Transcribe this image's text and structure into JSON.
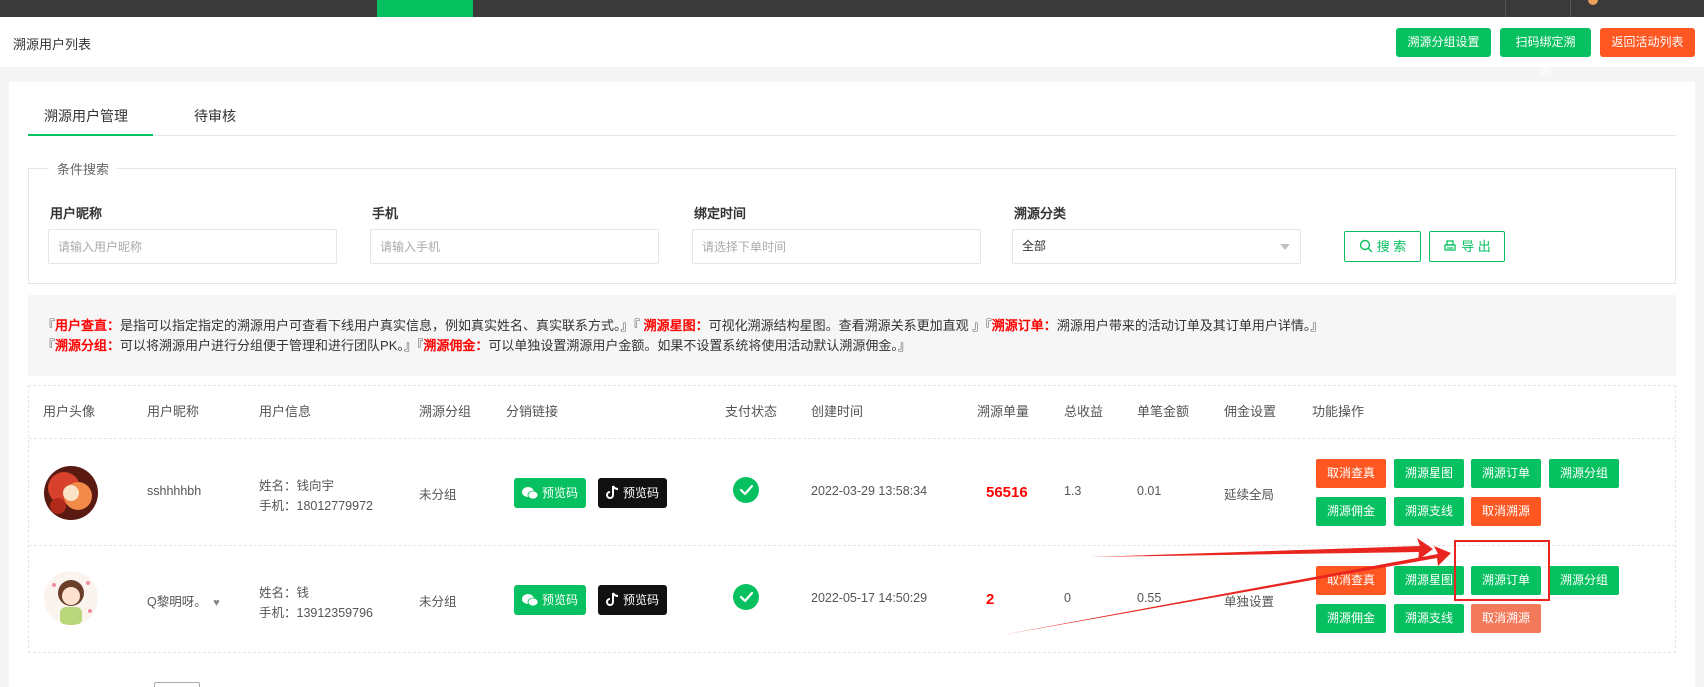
{
  "header": {
    "title": "溯源用户列表",
    "buttons": {
      "group_settings": "溯源分组设置",
      "scan_bind": "扫码绑定溯源",
      "back_to_list": "返回活动列表"
    }
  },
  "tabs": [
    {
      "label": "溯源用户管理",
      "active": true
    },
    {
      "label": "待审核",
      "active": false
    }
  ],
  "search": {
    "legend": "条件搜索",
    "fields": {
      "nickname": {
        "label": "用户昵称",
        "placeholder": "请输入用户昵称"
      },
      "phone": {
        "label": "手机",
        "placeholder": "请输入手机"
      },
      "bind_time": {
        "label": "绑定时间",
        "placeholder": "请选择下单时间"
      },
      "category": {
        "label": "溯源分类",
        "value": "全部"
      }
    },
    "search_button": "搜 索",
    "export_button": "导 出"
  },
  "notice": {
    "line1": [
      {
        "t": "『",
        "k": false
      },
      {
        "t": "用户查直：",
        "k": true
      },
      {
        "t": "是指可以指定指定的溯源用户可查看下线用户真实信息，例如真实姓名、真实联系方式。』『 ",
        "k": false
      },
      {
        "t": "溯源星图：",
        "k": true
      },
      {
        "t": "可视化溯源结构星图。查看溯源关系更加直观 』『",
        "k": false
      },
      {
        "t": "溯源订单：",
        "k": true
      },
      {
        "t": "溯源用户带来的活动订单及其订单用户详情。』",
        "k": false
      }
    ],
    "line2": [
      {
        "t": "『",
        "k": false
      },
      {
        "t": "溯源分组：",
        "k": true
      },
      {
        "t": "可以将溯源用户进行分组便于管理和进行团队PK。』『",
        "k": false
      },
      {
        "t": "溯源佣金：",
        "k": true
      },
      {
        "t": "可以单独设置溯源用户金额。如果不设置系统将使用活动默认溯源佣金。』",
        "k": false
      }
    ]
  },
  "table": {
    "headers": [
      "用户头像",
      "用户昵称",
      "用户信息",
      "溯源分组",
      "分销链接",
      "支付状态",
      "创建时间",
      "溯源单量",
      "总收益",
      "单笔金额",
      "佣金设置",
      "功能操作"
    ],
    "rows": [
      {
        "nickname": "sshhhhbh",
        "name": "姓名：钱向宇",
        "phone": "手机：18012779972",
        "group": "未分组",
        "wx_btn": "预览码",
        "dy_btn": "预览码",
        "created": "2022-03-29 13:58:34",
        "orders": "56516",
        "income": "1.3",
        "unit": "0.01",
        "commission": "延续全局",
        "ops": [
          "取消查真",
          "溯源星图",
          "溯源订单",
          "溯源分组",
          "溯源佣金",
          "溯源支线",
          "取消溯源"
        ]
      },
      {
        "nickname": "Q黎明呀。",
        "name": "姓名：钱",
        "phone": "手机：13912359796",
        "group": "未分组",
        "wx_btn": "预览码",
        "dy_btn": "预览码",
        "created": "2022-05-17 14:50:29",
        "orders": "2",
        "income": "0",
        "unit": "0.55",
        "commission": "单独设置",
        "ops": [
          "取消查真",
          "溯源星图",
          "溯源订单",
          "溯源分组",
          "溯源佣金",
          "溯源支线",
          "取消溯源"
        ]
      }
    ]
  },
  "colors": {
    "primary": "#07c160",
    "danger": "#ff5722",
    "annotation": "#e8251e"
  }
}
